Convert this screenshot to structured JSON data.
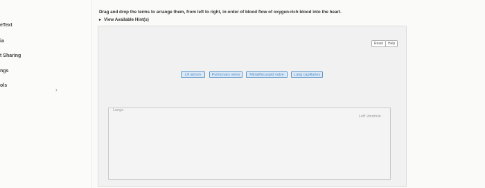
{
  "sidebar": {
    "items": [
      "eText",
      "ia",
      "t Sharing",
      "ngs",
      "ols"
    ],
    "chevron": "›"
  },
  "question": {
    "instruction": "Drag and drop the terms to arrange them, from left to right, in order of blood flow of oxygen-rich blood into the heart.",
    "hints_caret": "▸",
    "hints_label": "View Available Hint(s)"
  },
  "toolbar": {
    "reset_label": "Reset",
    "help_label": "Help"
  },
  "tiles": [
    "Lft atrium",
    "Pulmonary veins",
    "Mitral/bicuspid valve",
    "Lung capillaries"
  ],
  "dropzone": {
    "left_label": "Lungs",
    "right_label": "Left Ventricle"
  }
}
